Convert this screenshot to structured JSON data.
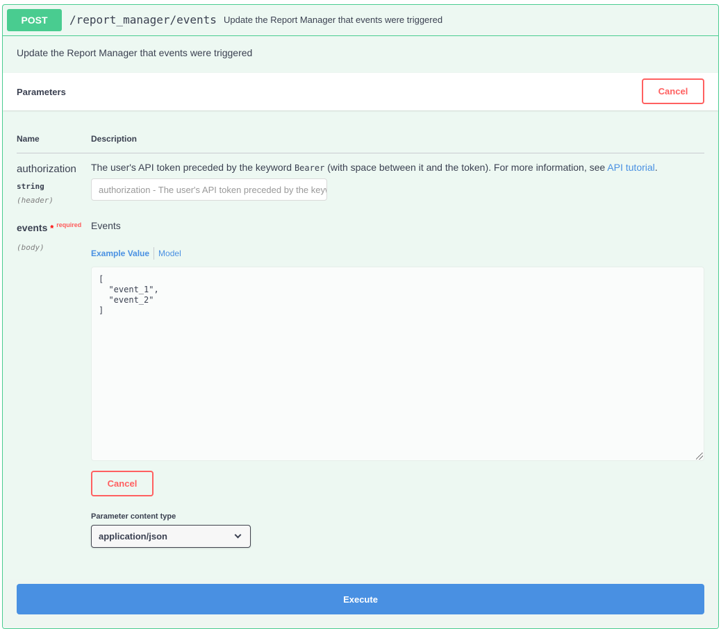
{
  "operation": {
    "method": "POST",
    "path": "/report_manager/events",
    "summary": "Update the Report Manager that events were triggered",
    "description": "Update the Report Manager that events were triggered"
  },
  "parameters_section": {
    "title": "Parameters",
    "cancel_label": "Cancel"
  },
  "table": {
    "name_header": "Name",
    "description_header": "Description"
  },
  "params": [
    {
      "name": "authorization",
      "type": "string",
      "in": "(header)",
      "description_prefix": "The user's API token preceded by the keyword ",
      "description_code": "Bearer",
      "description_suffix": " (with space between it and the token). For more information, see ",
      "link_text": "API tutorial",
      "description_end": ".",
      "placeholder": "authorization - The user's API token preceded by the keyword Bearer"
    },
    {
      "name": "events",
      "required_star": "*",
      "required_label": "required",
      "in": "(body)",
      "description": "Events",
      "tab_example": "Example Value",
      "tab_model": "Model",
      "body_value": "[\n  \"event_1\",\n  \"event_2\"\n]",
      "cancel_label": "Cancel",
      "content_type_label": "Parameter content type",
      "content_type_selected": "application/json"
    }
  ],
  "execute_label": "Execute",
  "colors": {
    "post_green": "#49cc90",
    "cancel_red": "#ff6060",
    "execute_blue": "#4990e2",
    "link_blue": "#4990e2"
  }
}
